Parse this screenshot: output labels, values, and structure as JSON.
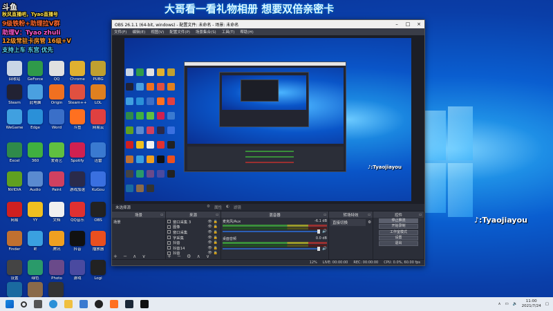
{
  "overlay": {
    "logo": "斗鱼",
    "line1": "秋风直播吧，Tyao直播号",
    "line2": "9级铁粉+助理拉V群",
    "line3": "助理V：Tyao zhuli",
    "line4": "12级常驻卡房管 16级+V",
    "line5": "支持上车 东宫 优先"
  },
  "banner": "大哥看一看礼物相册 想要双倍亲密卡",
  "watermarks": {
    "inner": ":Tyaojiayou",
    "outer": ":Tyaojiayou"
  },
  "desktop_icons": [
    {
      "label": "回收站",
      "color": "#c9d6e6"
    },
    {
      "label": "GeForce",
      "color": "#2f9a4a"
    },
    {
      "label": "QQ",
      "color": "#e0e0e0"
    },
    {
      "label": "Chrome",
      "color": "#e0b030"
    },
    {
      "label": "PUBG",
      "color": "#c0a030"
    },
    {
      "label": "Steam",
      "color": "#223"
    },
    {
      "label": "此电脑",
      "color": "#4aa0e0"
    },
    {
      "label": "Origin",
      "color": "#f07020"
    },
    {
      "label": "Steam++",
      "color": "#e05040"
    },
    {
      "label": "LOL",
      "color": "#e08020"
    },
    {
      "label": "WeGame",
      "color": "#40a0e0"
    },
    {
      "label": "Edge",
      "color": "#2a90d8"
    },
    {
      "label": "Word",
      "color": "#3a6fc8"
    },
    {
      "label": "斗鱼",
      "color": "#ff7020"
    },
    {
      "label": "网易云",
      "color": "#e04040"
    },
    {
      "label": "Excel",
      "color": "#2f8a4a"
    },
    {
      "label": "360",
      "color": "#40b040"
    },
    {
      "label": "爱奇艺",
      "color": "#60c040"
    },
    {
      "label": "Spotify",
      "color": "#d02050"
    },
    {
      "label": "迅雷",
      "color": "#3a7ad0"
    },
    {
      "label": "NVIDIA",
      "color": "#60a020"
    },
    {
      "label": "Audio",
      "color": "#5a8ad0"
    },
    {
      "label": "Paint",
      "color": "#d04060"
    },
    {
      "label": "游戏加速",
      "color": "#2a2a4a"
    },
    {
      "label": "KuGou",
      "color": "#3a70e0"
    },
    {
      "label": "网易",
      "color": "#d02020"
    },
    {
      "label": "YY",
      "color": "#f0c020"
    },
    {
      "label": "文档",
      "color": "#f0f0f0"
    },
    {
      "label": "QQ音乐",
      "color": "#e03030"
    },
    {
      "label": "OBS",
      "color": "#222"
    },
    {
      "label": "Finder",
      "color": "#c07030"
    },
    {
      "label": "IE",
      "color": "#3aa0e0"
    },
    {
      "label": "腾讯",
      "color": "#f0a020"
    },
    {
      "label": "抖音",
      "color": "#111"
    },
    {
      "label": "播放器",
      "color": "#ea4f1f"
    },
    {
      "label": "设置",
      "color": "#444"
    },
    {
      "label": "绿色",
      "color": "#2a9a6a"
    },
    {
      "label": "Photo",
      "color": "#6a4a8a"
    },
    {
      "label": "游戏",
      "color": "#4a4aa0"
    },
    {
      "label": "Logi",
      "color": "#222"
    },
    {
      "label": "Battle",
      "color": "#1a6aa0"
    },
    {
      "label": "图片",
      "color": "#8a6a4a"
    },
    {
      "label": "CPU-Z",
      "color": "#333"
    }
  ],
  "obs": {
    "title": "OBS 26.1.1 (64-bit, windows) - 配置文件: 未命名 - 场景: 未命名",
    "menu": [
      "文件(F)",
      "编辑(E)",
      "视图(V)",
      "配置文件(P)",
      "场景集合(S)",
      "工具(T)",
      "帮助(H)"
    ],
    "window_controls": [
      "–",
      "□",
      "×"
    ],
    "dock_bar": {
      "left": "未选择源",
      "props": "属性",
      "filters": "滤镜"
    },
    "docks": {
      "scenes": {
        "title": "场景",
        "items": [
          "场景"
        ]
      },
      "sources": {
        "title": "来源",
        "items": [
          "窗口采集 3",
          "图像",
          "窗口采集",
          "字采集",
          "抖音",
          "抖音14",
          "抖音"
        ]
      },
      "mixer": {
        "title": "混音器",
        "channels": [
          {
            "name": "麦克风/Aux",
            "db": "-6.1 dB"
          },
          {
            "name": "桌面音频",
            "db": "0.0 dB"
          }
        ]
      },
      "transitions": {
        "title": "转场特效",
        "type": "直接切换"
      },
      "controls": {
        "title": "控件",
        "buttons": [
          "停止推流",
          "开始录制",
          "工作室模式",
          "设置",
          "退出"
        ]
      }
    },
    "status": {
      "live": "LIVE: 00:00:00",
      "rec": "REC: 00:00:00",
      "cpu": "CPU: 0.0%, 60.00 fps",
      "frames": "12%"
    }
  },
  "taskbar": {
    "time": "11:00",
    "date": "2021/7/24"
  }
}
